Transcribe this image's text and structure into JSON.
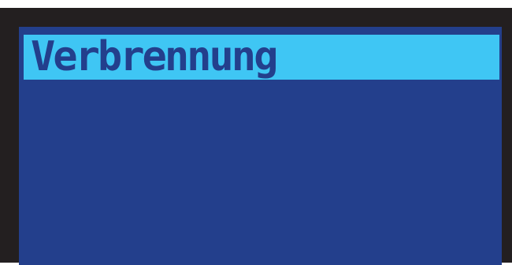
{
  "display": {
    "title": "Verbrennung",
    "colors": {
      "bezel": "#231f20",
      "background": "#233f8c",
      "highlight": "#3fc6f4",
      "text": "#233f8c"
    }
  }
}
